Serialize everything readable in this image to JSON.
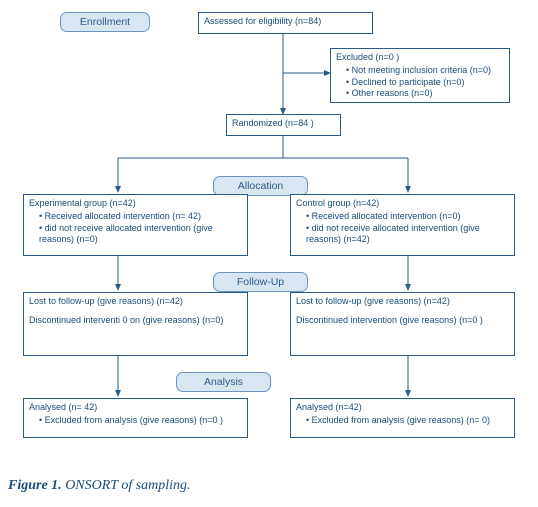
{
  "phases": {
    "enrollment": "Enrollment",
    "allocation": "Allocation",
    "followup": "Follow-Up",
    "analysis": "Analysis"
  },
  "boxes": {
    "assessed": "Assessed for eligibility (n=84)",
    "excluded": {
      "title": "Excluded (n=0  )",
      "items": [
        "Not meeting inclusion criteria (n=0)",
        "Declined to participate (n=0)",
        "Other reasons (n=0)"
      ]
    },
    "randomized": "Randomized (n=84  )",
    "alloc_exp": {
      "title": "Experimental group (n=42)",
      "items": [
        "Received allocated intervention (n= 42)",
        "did not receive allocated intervention (give reasons) (n=0)"
      ]
    },
    "alloc_ctrl": {
      "title": "Control group (n=42)",
      "items": [
        "Received allocated intervention (n=0)",
        "did not receive allocated intervention (give reasons) (n=42)"
      ]
    },
    "fu_exp": {
      "line1": "Lost to follow-up (give reasons) (n=42)",
      "line2": "Discontinued interventi 0 on (give reasons) (n=0)"
    },
    "fu_ctrl": {
      "line1": "Lost to follow-up (give reasons) (n=42)",
      "line2": "Discontinued intervention (give reasons) (n=0 )"
    },
    "an_exp": {
      "title": "Analysed (n= 42)",
      "items": [
        "Excluded from analysis (give reasons) (n=0  )"
      ]
    },
    "an_ctrl": {
      "title": "Analysed (n=42)",
      "items": [
        "Excluded from analysis (give reasons) (n= 0)"
      ]
    }
  },
  "caption": {
    "label": "Figure 1.",
    "text": " ONSORT of sampling."
  }
}
